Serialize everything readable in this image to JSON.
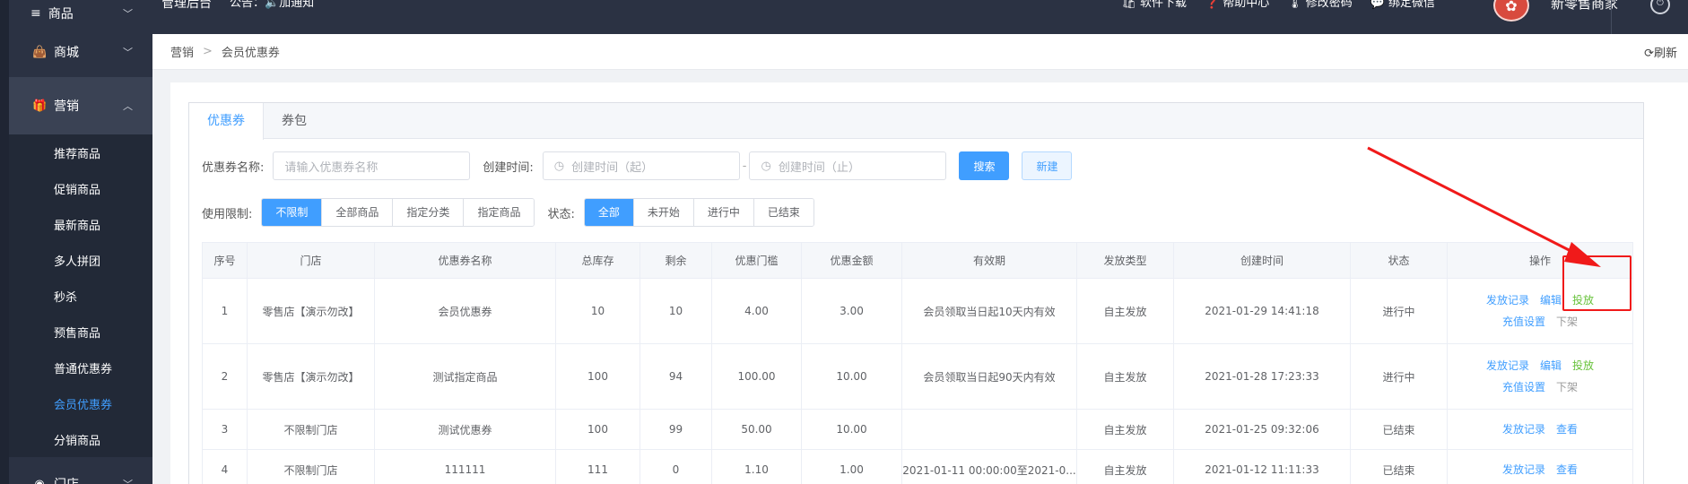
{
  "sidebar": {
    "top_item": {
      "icon": "≡",
      "label": "商品"
    },
    "groups": [
      {
        "icon": "shop-bag-icon",
        "label": "商城"
      },
      {
        "icon": "gift-icon",
        "label": "营销"
      },
      {
        "icon": "circle-icon",
        "label": "门店"
      }
    ],
    "submenu": [
      "推荐商品",
      "促销商品",
      "最新商品",
      "多人拼团",
      "秒杀",
      "预售商品",
      "普通优惠券",
      "会员优惠券",
      "分销商品"
    ]
  },
  "header": {
    "title": "管理后台",
    "notice": "公告：🔈加通知",
    "links": [
      {
        "icon": "🛍",
        "label": "软件下载"
      },
      {
        "icon": "❓",
        "label": "帮助中心"
      },
      {
        "icon": "🌡",
        "label": "修改密码"
      },
      {
        "icon": "💬",
        "label": "绑定微信"
      }
    ],
    "shop_name": "新零售商家"
  },
  "breadcrumb": {
    "items": [
      "营销",
      "会员优惠券"
    ],
    "refresh": "刷新"
  },
  "tabs": [
    {
      "label": "优惠券"
    },
    {
      "label": "券包"
    }
  ],
  "filters": {
    "name_label": "优惠券名称:",
    "name_placeholder": "请输入优惠券名称",
    "time_label": "创建时间:",
    "time_start": "创建时间（起）",
    "time_end": "创建时间（止）",
    "range_sep": "-",
    "search": "搜索",
    "create": "新建",
    "limit_label": "使用限制:",
    "limit_options": [
      "不限制",
      "全部商品",
      "指定分类",
      "指定商品"
    ],
    "status_label": "状态:",
    "status_options": [
      "全部",
      "未开始",
      "进行中",
      "已结束"
    ]
  },
  "table": {
    "headers": [
      "序号",
      "门店",
      "优惠券名称",
      "总库存",
      "剩余",
      "优惠门槛",
      "优惠金额",
      "有效期",
      "发放类型",
      "创建时间",
      "状态",
      "操作"
    ],
    "rows": [
      {
        "no": "1",
        "store": "零售店【演示勿改】",
        "name": "会员优惠券",
        "total": "10",
        "left": "10",
        "threshold": "4.00",
        "amount": "3.00",
        "validity": "会员领取当日起10天内有效",
        "type": "自主发放",
        "created": "2021-01-29 14:41:18",
        "status": "进行中",
        "ops": {
          "records": "发放记录",
          "edit": "编辑",
          "deliver": "投放",
          "recharge": "充值设置",
          "offline": "下架"
        }
      },
      {
        "no": "2",
        "store": "零售店【演示勿改】",
        "name": "测试指定商品",
        "total": "100",
        "left": "94",
        "threshold": "100.00",
        "amount": "10.00",
        "validity": "会员领取当日起90天内有效",
        "type": "自主发放",
        "created": "2021-01-28 17:23:33",
        "status": "进行中",
        "ops": {
          "records": "发放记录",
          "edit": "编辑",
          "deliver": "投放",
          "recharge": "充值设置",
          "offline": "下架"
        }
      },
      {
        "no": "3",
        "store": "不限制门店",
        "name": "测试优惠券",
        "total": "100",
        "left": "99",
        "threshold": "50.00",
        "amount": "10.00",
        "validity": "",
        "type": "自主发放",
        "created": "2021-01-25 09:32:06",
        "status": "已结束",
        "ops": {
          "records": "发放记录",
          "view": "查看"
        }
      },
      {
        "no": "4",
        "store": "不限制门店",
        "name": "111111",
        "total": "111",
        "left": "0",
        "threshold": "1.10",
        "amount": "1.00",
        "validity": "2021-01-11 00:00:00至2021-0...",
        "type": "自主发放",
        "created": "2021-01-12 11:11:33",
        "status": "已结束",
        "ops": {
          "records": "发放记录",
          "view": "查看"
        }
      }
    ]
  },
  "colors": {
    "sidebar": "#2b3243",
    "primary": "#409eff",
    "success": "#67c23a",
    "annotation": "#f01a1a"
  }
}
